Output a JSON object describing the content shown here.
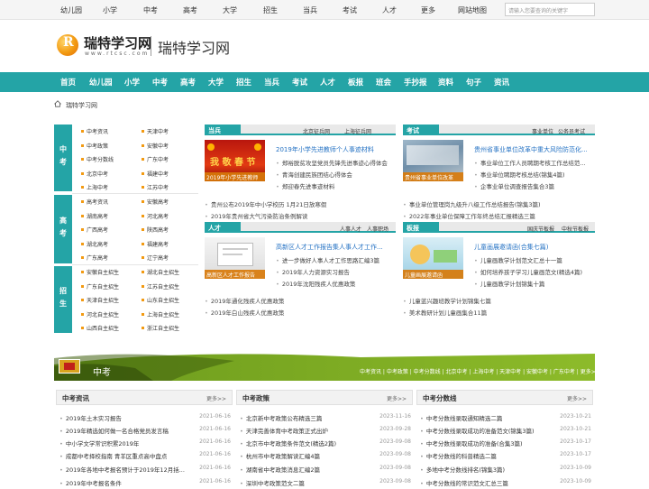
{
  "topbar": {
    "links": [
      "幼儿园",
      "小学",
      "中考",
      "高考",
      "大学",
      "招生",
      "当兵",
      "考试",
      "人才",
      "更多",
      "网站地图"
    ],
    "search_placeholder": "请输入您要查询的关键字"
  },
  "logo": {
    "mark": "R",
    "name": "瑞特学习网",
    "url": "www.rtcsc.com",
    "site_title": "瑞特学习网"
  },
  "nav": [
    "首页",
    "幼儿园",
    "小学",
    "中考",
    "高考",
    "大学",
    "招生",
    "当兵",
    "考试",
    "人才",
    "板报",
    "班会",
    "手抄报",
    "资料",
    "句子",
    "资讯"
  ],
  "breadcrumb": "瑞特学习网",
  "categories": {
    "zhongkao": {
      "label": "中考",
      "col1": [
        "中考资讯",
        "中考政策",
        "中考分数线",
        "北京中考",
        "上海中考"
      ],
      "col2": [
        "天津中考",
        "安徽中考",
        "广东中考",
        "福建中考",
        "江苏中考"
      ]
    },
    "gaokao": {
      "label": "高考",
      "col1": [
        "高考资讯",
        "湖南高考",
        "广西高考",
        "湖北高考",
        "广东高考"
      ],
      "col2": [
        "安徽高考",
        "河北高考",
        "陕西高考",
        "福建高考",
        "辽宁高考"
      ]
    },
    "zhaosheng": {
      "label": "招生",
      "col1": [
        "安徽自主招生",
        "广东自主招生",
        "天津自主招生",
        "河北自主招生",
        "山西自主招生"
      ],
      "col2": [
        "湖北自主招生",
        "江苏自主招生",
        "山东自主招生",
        "上海自主招生",
        "浙江自主招生"
      ]
    }
  },
  "panels": {
    "dangbing": {
      "title": "当兵",
      "links": [
        "北京征兵网",
        "上海征兵网"
      ],
      "thumb_caption": "2019年小学先进教师",
      "headline": "2019年小学先进教师个人事迹材料",
      "items": [
        "郑裕脱贫攻坚党员先锋先进事迹心得体会",
        "青海创建民族团结心得体会",
        "郑迎春先进事迹材料"
      ],
      "more": [
        "贵州公布2019年中小学校历 1月21日放寒假",
        "2019年贵州省大气污染防治条例解读"
      ]
    },
    "kaoshi": {
      "title": "考试",
      "links": [
        "事业单位",
        "公务员考试"
      ],
      "thumb_caption": "贵州省事业单位改革",
      "headline": "贵州省事业单位改革中重大风险防范化...",
      "items": [
        "事业单位工作人员聘期考核工作总结范...",
        "事业单位聘期考核总结(锦集4篇)",
        "企事业单位调查报告集合3篇"
      ],
      "more": [
        "事业单位管理岗九级升八级工作总结报告(锦集3篇)",
        "2022年事业单位保障工作年终总结汇报精选三篇"
      ]
    },
    "rencai": {
      "title": "人才",
      "links": [
        "人事人才",
        "人事职场"
      ],
      "thumb_caption": "高新区人才工作报告",
      "headline": "高新区人才工作报告集人事人才工作...",
      "items": [
        "进一步做好人事人才工作思路汇编3篇",
        "2019年人力资源实习报告",
        "2019年沈阳残疾人优惠政策"
      ],
      "more": [
        "2019年通化残疾人优惠政策",
        "2019年白山残疾人优惠政策"
      ]
    },
    "banbao": {
      "title": "板报",
      "links": [
        "国庆节板报",
        "中秋节板报"
      ],
      "thumb_caption": "儿童画展邀请函",
      "headline": "儿童画展邀请函(合集七篇)",
      "items": [
        "儿童画教学计划范文汇总十一篇",
        "如何培养孩子学习儿童画范文(精选4篇)",
        "儿童画教学计划锦集十篇"
      ],
      "more": [
        "儿童蓝兴趣班教学计划锦集七篇",
        "美术教研计划儿童画集合11篇"
      ]
    }
  },
  "zhongkao_section": {
    "title": "中考",
    "links": "中考资讯 | 中考政策 | 中考分数线 | 北京中考 | 上海中考 | 天津中考 | 安徽中考 | 广东中考 | 更多>>",
    "columns": [
      {
        "title": "中考资讯",
        "more": "更多>>",
        "rows": [
          {
            "t": "2019年土木实习报告",
            "d": "2021-06-16"
          },
          {
            "t": "2019年精选如何做一名合格党员发言稿",
            "d": "2021-06-16"
          },
          {
            "t": "中小学文学常识积累2019年",
            "d": "2021-06-16"
          },
          {
            "t": "成都中考择校指南 青羊区重点高中盘点",
            "d": "2021-06-16"
          },
          {
            "t": "2019年各地中考报名预计于2019年12月括...",
            "d": "2021-06-16"
          },
          {
            "t": "2019年中考报名条件",
            "d": "2021-06-16"
          }
        ]
      },
      {
        "title": "中考政策",
        "more": "更多>>",
        "rows": [
          {
            "t": "北京新中考政策公布精选三篇",
            "d": "2023-11-16"
          },
          {
            "t": "天津完善体育中考政策正式出炉",
            "d": "2023-09-28"
          },
          {
            "t": "北京市中考政策条件范文(精选2篇)",
            "d": "2023-09-08"
          },
          {
            "t": "杭州市中考政策解读汇编4篇",
            "d": "2023-09-08"
          },
          {
            "t": "湖南省中考政策消息汇编2篇",
            "d": "2023-09-08"
          },
          {
            "t": "深圳中考政策范文二篇",
            "d": "2023-09-08"
          }
        ]
      },
      {
        "title": "中考分数线",
        "more": "更多>>",
        "rows": [
          {
            "t": "中考分数线录取通知精选二篇",
            "d": "2023-10-21"
          },
          {
            "t": "中考分数线录取成功的准备范文(锦集3篇)",
            "d": "2023-10-21"
          },
          {
            "t": "中考分数线录取成功的准备(合集3篇)",
            "d": "2023-10-17"
          },
          {
            "t": "中考分数线的科普精选二篇",
            "d": "2023-10-17"
          },
          {
            "t": "多地中考分数线排名(锦集3篇)",
            "d": "2023-10-09"
          },
          {
            "t": "中考分数线的常识范文汇总三篇",
            "d": "2023-10-09"
          }
        ]
      }
    ]
  }
}
